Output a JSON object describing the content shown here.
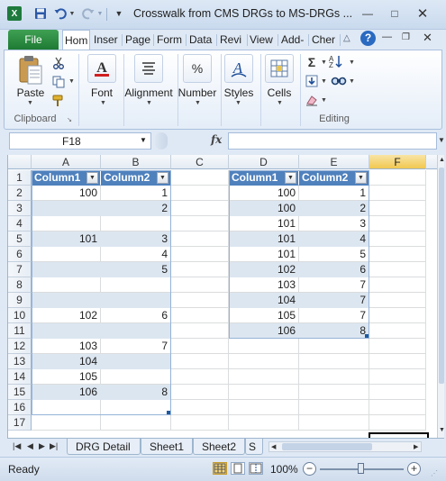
{
  "window": {
    "title": "Crosswalk from CMS DRGs to MS-DRGs ...",
    "controls": {
      "minimize": "—",
      "maximize": "□",
      "close": "✕"
    }
  },
  "quick_access": {
    "logo": "X",
    "customize": "▼"
  },
  "ribbon": {
    "tabs": [
      {
        "label": "File"
      },
      {
        "label": "Hom"
      },
      {
        "label": "Inser"
      },
      {
        "label": "Page"
      },
      {
        "label": "Form"
      },
      {
        "label": "Data"
      },
      {
        "label": "Revi"
      },
      {
        "label": "View"
      },
      {
        "label": "Add-"
      },
      {
        "label": "Cher"
      }
    ],
    "groups": {
      "clipboard": {
        "label": "Clipboard",
        "paste_label": "Paste"
      },
      "font": {
        "label": "Font"
      },
      "alignment": {
        "label": "Alignment"
      },
      "number": {
        "label": "Number",
        "icon_text": "%"
      },
      "styles": {
        "label": "Styles"
      },
      "cells": {
        "label": "Cells"
      },
      "editing": {
        "label": "Editing"
      }
    }
  },
  "formula_bar": {
    "name_box": "F18",
    "fx_label": "fx",
    "formula": ""
  },
  "sheet": {
    "columns": [
      "A",
      "B",
      "C",
      "D",
      "E",
      "F"
    ],
    "active_column": "F",
    "rows": [
      "1",
      "2",
      "3",
      "4",
      "5",
      "6",
      "7",
      "8",
      "9",
      "10",
      "11",
      "12",
      "13",
      "14",
      "15",
      "16",
      "17"
    ],
    "table1": {
      "headers": [
        "Column1",
        "Column2"
      ],
      "rows": [
        [
          "100",
          "1"
        ],
        [
          "",
          "2"
        ],
        [
          "",
          ""
        ],
        [
          "101",
          "3"
        ],
        [
          "",
          "4"
        ],
        [
          "",
          "5"
        ],
        [
          "",
          ""
        ],
        [
          "",
          ""
        ],
        [
          "102",
          "6"
        ],
        [
          "",
          ""
        ],
        [
          "103",
          "7"
        ],
        [
          "104",
          ""
        ],
        [
          "105",
          ""
        ],
        [
          "106",
          "8"
        ],
        [
          "",
          ""
        ]
      ]
    },
    "table2": {
      "headers": [
        "Column1",
        "Column2"
      ],
      "rows": [
        [
          "100",
          "1"
        ],
        [
          "100",
          "2"
        ],
        [
          "101",
          "3"
        ],
        [
          "101",
          "4"
        ],
        [
          "101",
          "5"
        ],
        [
          "102",
          "6"
        ],
        [
          "103",
          "7"
        ],
        [
          "104",
          "7"
        ],
        [
          "105",
          "7"
        ],
        [
          "106",
          "8"
        ]
      ]
    }
  },
  "sheet_tabs": [
    "DRG Detail",
    "Sheet1",
    "Sheet2",
    "S"
  ],
  "status": {
    "text": "Ready",
    "zoom": "100%",
    "zoom_out": "−",
    "zoom_in": "+"
  },
  "colors": {
    "header_blue": "#4f81bd",
    "band_blue": "#dce6f1",
    "file_green": "#1d7a33",
    "excel_green": "#1e7a3c"
  }
}
